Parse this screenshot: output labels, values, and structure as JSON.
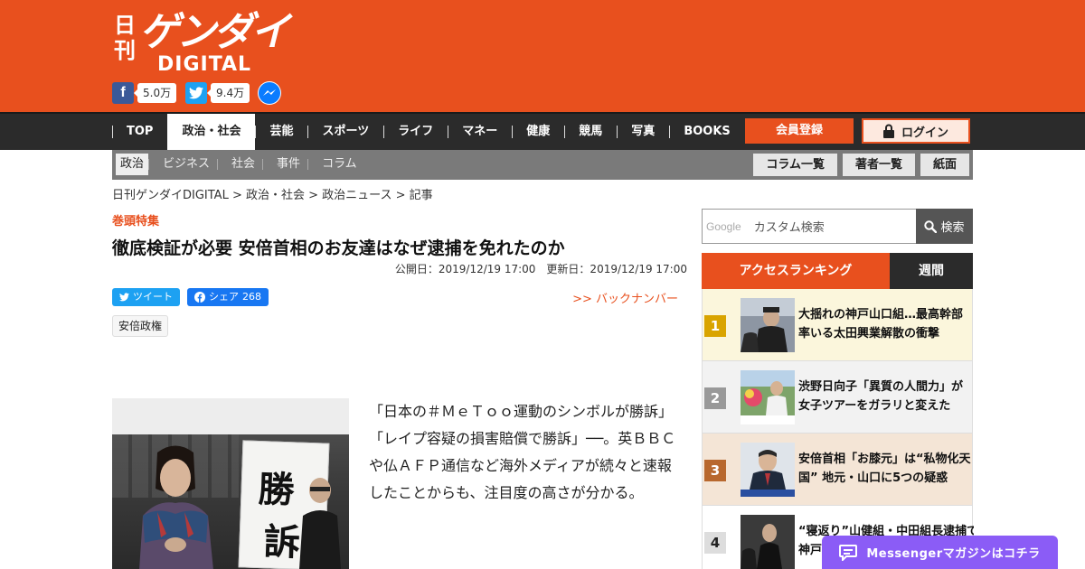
{
  "header": {
    "logo_nikkan": "日刊",
    "logo_main": "ゲンダイ",
    "logo_sub": "DIGITAL",
    "social": {
      "facebook_count": "5.0万",
      "twitter_count": "9.4万"
    }
  },
  "mainnav": {
    "items": [
      "TOP",
      "政治・社会",
      "芸能",
      "スポーツ",
      "ライフ",
      "マネー",
      "健康",
      "競馬",
      "写真",
      "BOOKS"
    ],
    "register": "会員登録",
    "login": "ログイン"
  },
  "subnav": {
    "items": [
      "政治",
      "ビジネス",
      "社会",
      "事件",
      "コラム"
    ],
    "buttons": [
      "コラム一覧",
      "著者一覧",
      "紙面"
    ]
  },
  "breadcrumb": "日刊ゲンダイDIGITAL > 政治・社会 > 政治ニュース > 記事",
  "article": {
    "kanto": "巻頭特集",
    "title": "徹底検証が必要 安倍首相のお友達はなぜ逮捕を免れたのか",
    "dates": "公開日：2019/12/19 17:00　更新日：2019/12/19 17:00",
    "tweet": "ツイート",
    "share": "シェア",
    "share_count": "268",
    "backnumber": ">> バックナンバー",
    "tag": "安倍政権",
    "photo_sign_1": "勝",
    "photo_sign_2": "訴",
    "body": "「日本の＃ＭｅＴｏｏ運動のシンボルが勝訴」「レイプ容疑の損害賠償で勝訴」──。英ＢＢＣや仏ＡＦＰ通信など海外メディアが続々と速報したことからも、注目度の高さが分かる。"
  },
  "sidebar": {
    "search": {
      "google": "Google",
      "placeholder": "カスタム検索",
      "button": "検索"
    },
    "ranking": {
      "tab_access": "アクセスランキング",
      "tab_week": "週間",
      "items": [
        {
          "num": "1",
          "line1": "大揺れの神戸山口組…最高幹部",
          "line2": "率いる太田興業解散の衝撃",
          "color": "#d9a400"
        },
        {
          "num": "2",
          "line1": "渋野日向子「異質の人間力」が",
          "line2": "女子ツアーをガラリと変えた",
          "color": "#999999"
        },
        {
          "num": "3",
          "line1": "安倍首相「お膝元」は“私物化天",
          "line2": "国” 地元・山口に5つの疑惑",
          "color": "#b8682e"
        },
        {
          "num": "4",
          "line1": "“寝返り”山健組・中田組長逮捕で",
          "line2": "神戸",
          "color": "#dddddd"
        }
      ]
    }
  },
  "messenger": "Messengerマガジンはコチラ",
  "colors": {
    "brand": "#e8501e",
    "nav_dark": "#2b2b2b",
    "messenger": "#8b5cf6"
  }
}
